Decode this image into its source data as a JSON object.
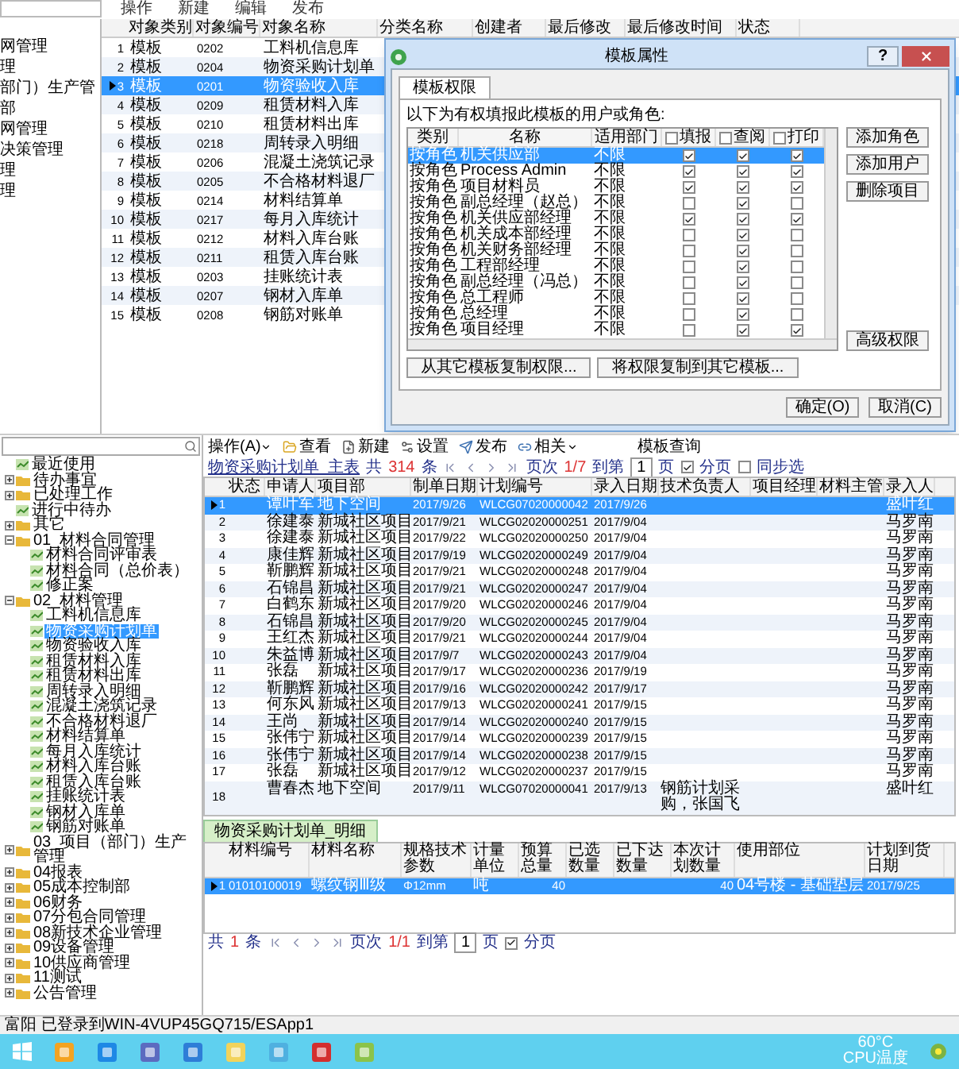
{
  "top_window": {
    "toolbar": [
      "操作",
      "新建",
      "编辑",
      "发布"
    ],
    "tree_fragment": [
      "网管理",
      "理",
      "部门）生产管",
      "部",
      "网管理",
      "决策管理",
      "理",
      "理"
    ],
    "grid": {
      "columns": [
        "对象类别",
        "对象编号",
        "对象名称",
        "分类名称",
        "创建者",
        "最后修改",
        "最后修改时间",
        "状态"
      ],
      "rows": [
        {
          "n": "1",
          "category": "模板",
          "code": "0202",
          "name": "工料机信息库",
          "selected": false
        },
        {
          "n": "2",
          "category": "模板",
          "code": "0204",
          "name": "物资采购计划单",
          "selected": false
        },
        {
          "n": "3",
          "category": "模板",
          "code": "0201",
          "name": "物资验收入库",
          "selected": true
        },
        {
          "n": "4",
          "category": "模板",
          "code": "0209",
          "name": "租赁材料入库",
          "selected": false
        },
        {
          "n": "5",
          "category": "模板",
          "code": "0210",
          "name": "租赁材料出库",
          "selected": false
        },
        {
          "n": "6",
          "category": "模板",
          "code": "0218",
          "name": "周转录入明细",
          "selected": false
        },
        {
          "n": "7",
          "category": "模板",
          "code": "0206",
          "name": "混凝土浇筑记录",
          "selected": false
        },
        {
          "n": "8",
          "category": "模板",
          "code": "0205",
          "name": "不合格材料退厂",
          "selected": false
        },
        {
          "n": "9",
          "category": "模板",
          "code": "0214",
          "name": "材料结算单",
          "selected": false
        },
        {
          "n": "10",
          "category": "模板",
          "code": "0217",
          "name": "每月入库统计",
          "selected": false
        },
        {
          "n": "11",
          "category": "模板",
          "code": "0212",
          "name": "材料入库台账",
          "selected": false
        },
        {
          "n": "12",
          "category": "模板",
          "code": "0211",
          "name": "租赁入库台账",
          "selected": false
        },
        {
          "n": "13",
          "category": "模板",
          "code": "0203",
          "name": "挂账统计表",
          "selected": false
        },
        {
          "n": "14",
          "category": "模板",
          "code": "0207",
          "name": "钢材入库单",
          "selected": false
        },
        {
          "n": "15",
          "category": "模板",
          "code": "0208",
          "name": "钢筋对账单",
          "selected": false
        }
      ]
    }
  },
  "dialog": {
    "title": "模板属性",
    "help_button": "?",
    "tabs": [
      {
        "label": "模板权限",
        "selected": true
      }
    ],
    "intro": "以下为有权填报此模板的用户或角色:",
    "columns": [
      "类别",
      "名称",
      "适用部门"
    ],
    "check_columns": [
      {
        "label": "填报",
        "checked": false
      },
      {
        "label": "查阅",
        "checked": false
      },
      {
        "label": "打印",
        "checked": false
      }
    ],
    "rows": [
      {
        "type": "按角色",
        "name": "机关供应部",
        "dept": "不限",
        "fill": true,
        "view": true,
        "print": true,
        "selected": true
      },
      {
        "type": "按角色",
        "name": "Process Admin",
        "dept": "不限",
        "fill": true,
        "view": true,
        "print": true,
        "selected": false
      },
      {
        "type": "按角色",
        "name": "项目材料员",
        "dept": "不限",
        "fill": true,
        "view": true,
        "print": true,
        "selected": false
      },
      {
        "type": "按角色",
        "name": "副总经理（赵总）",
        "dept": "不限",
        "fill": false,
        "view": true,
        "print": false,
        "selected": false
      },
      {
        "type": "按角色",
        "name": "机关供应部经理",
        "dept": "不限",
        "fill": true,
        "view": true,
        "print": true,
        "selected": false
      },
      {
        "type": "按角色",
        "name": "机关成本部经理",
        "dept": "不限",
        "fill": false,
        "view": true,
        "print": false,
        "selected": false
      },
      {
        "type": "按角色",
        "name": "机关财务部经理",
        "dept": "不限",
        "fill": false,
        "view": true,
        "print": false,
        "selected": false
      },
      {
        "type": "按角色",
        "name": "工程部经理",
        "dept": "不限",
        "fill": false,
        "view": true,
        "print": false,
        "selected": false
      },
      {
        "type": "按角色",
        "name": "副总经理（冯总）",
        "dept": "不限",
        "fill": false,
        "view": true,
        "print": false,
        "selected": false
      },
      {
        "type": "按角色",
        "name": "总工程师",
        "dept": "不限",
        "fill": false,
        "view": true,
        "print": false,
        "selected": false
      },
      {
        "type": "按角色",
        "name": "总经理",
        "dept": "不限",
        "fill": false,
        "view": true,
        "print": false,
        "selected": false
      },
      {
        "type": "按角色",
        "name": "项目经理",
        "dept": "不限",
        "fill": false,
        "view": true,
        "print": true,
        "selected": false
      }
    ],
    "side_buttons": [
      "添加角色",
      "添加用户",
      "删除项目"
    ],
    "advanced_button": "高级权限",
    "copy_buttons": [
      "从其它模板复制权限...",
      "将权限复制到其它模板..."
    ],
    "ok_button": "确定(O)",
    "cancel_button": "取消(C)"
  },
  "bottom_window": {
    "toolbar": {
      "menu": "操作(A)",
      "buttons": [
        {
          "label": "查看",
          "kind": "view"
        },
        {
          "label": "新建",
          "kind": "new"
        },
        {
          "label": "设置",
          "kind": "settings"
        },
        {
          "label": "发布",
          "kind": "publish"
        },
        {
          "label": "相关",
          "kind": "related"
        }
      ],
      "title": "模板查询"
    },
    "tree": [
      {
        "label": "最近使用",
        "kind": "doc"
      },
      {
        "label": "待办事宜",
        "kind": "folder",
        "expanded": false
      },
      {
        "label": "已处理工作",
        "kind": "folder",
        "expanded": false
      },
      {
        "label": "进行中待办",
        "kind": "doc"
      },
      {
        "label": "其它",
        "kind": "folder",
        "expanded": false
      },
      {
        "label": "01_材料合同管理",
        "kind": "folder",
        "expanded": true,
        "children": [
          {
            "label": "材料合同评审表",
            "kind": "doc"
          },
          {
            "label": "材料合同（总价表）",
            "kind": "doc"
          },
          {
            "label": "修正案",
            "kind": "doc"
          }
        ]
      },
      {
        "label": "02_材料管理",
        "kind": "folder",
        "expanded": true,
        "children": [
          {
            "label": "工料机信息库",
            "kind": "doc"
          },
          {
            "label": "物资采购计划单",
            "kind": "doc",
            "selected": true
          },
          {
            "label": "物资验收入库",
            "kind": "doc"
          },
          {
            "label": "租赁材料入库",
            "kind": "doc"
          },
          {
            "label": "租赁材料出库",
            "kind": "doc"
          },
          {
            "label": "周转录入明细",
            "kind": "doc"
          },
          {
            "label": "混凝土浇筑记录",
            "kind": "doc"
          },
          {
            "label": "不合格材料退厂",
            "kind": "doc"
          },
          {
            "label": "材料结算单",
            "kind": "doc"
          },
          {
            "label": "每月入库统计",
            "kind": "doc"
          },
          {
            "label": "材料入库台账",
            "kind": "doc"
          },
          {
            "label": "租赁入库台账",
            "kind": "doc"
          },
          {
            "label": "挂账统计表",
            "kind": "doc"
          },
          {
            "label": "钢材入库单",
            "kind": "doc"
          },
          {
            "label": "钢筋对账单",
            "kind": "doc"
          }
        ]
      },
      {
        "label": "03_项目（部门）生产管理",
        "kind": "folder",
        "expanded": false
      },
      {
        "label": "04报表",
        "kind": "folder",
        "expanded": false
      },
      {
        "label": "05成本控制部",
        "kind": "folder",
        "expanded": false
      },
      {
        "label": "06财务",
        "kind": "folder",
        "expanded": false
      },
      {
        "label": "07分包合同管理",
        "kind": "folder",
        "expanded": false
      },
      {
        "label": "08新技术企业管理",
        "kind": "folder",
        "expanded": false
      },
      {
        "label": "09设备管理",
        "kind": "folder",
        "expanded": false
      },
      {
        "label": "10供应商管理",
        "kind": "folder",
        "expanded": false
      },
      {
        "label": "11测试",
        "kind": "folder",
        "expanded": false
      },
      {
        "label": "公告管理",
        "kind": "folder",
        "expanded": false
      }
    ],
    "master_pager": {
      "table_name": "物资采购计划单_主表",
      "total_label": "共",
      "total": "314",
      "unit": "条",
      "page_label": "页次",
      "page": "1/7",
      "goto_label": "到第",
      "goto_value": "1",
      "page_unit": "页",
      "paging": {
        "label": "分页",
        "checked": true
      },
      "sync": {
        "label": "同步选",
        "checked": false
      }
    },
    "master": {
      "columns": [
        "状态",
        "申请人",
        "项目部",
        "制单日期",
        "计划编号",
        "录入日期",
        "技术负责人",
        "项目经理",
        "材料主管",
        "录入人"
      ],
      "rows": [
        {
          "n": "1",
          "applicant": "谭叶军",
          "project": "地下空间",
          "date": "2017/9/26",
          "plan": "WLCG07020000042",
          "entered": "2017/9/26",
          "tech": "",
          "clerk": "盛叶红",
          "selected": true
        },
        {
          "n": "2",
          "applicant": "徐建泰",
          "project": "新城社区项目",
          "date": "2017/9/21",
          "plan": "WLCG02020000251",
          "entered": "2017/9/04",
          "tech": "",
          "clerk": "马罗南",
          "selected": false
        },
        {
          "n": "3",
          "applicant": "徐建泰",
          "project": "新城社区项目",
          "date": "2017/9/22",
          "plan": "WLCG02020000250",
          "entered": "2017/9/04",
          "tech": "",
          "clerk": "马罗南",
          "selected": false
        },
        {
          "n": "4",
          "applicant": "康佳辉",
          "project": "新城社区项目",
          "date": "2017/9/19",
          "plan": "WLCG02020000249",
          "entered": "2017/9/04",
          "tech": "",
          "clerk": "马罗南",
          "selected": false
        },
        {
          "n": "5",
          "applicant": "靳鹏辉",
          "project": "新城社区项目",
          "date": "2017/9/21",
          "plan": "WLCG02020000248",
          "entered": "2017/9/04",
          "tech": "",
          "clerk": "马罗南",
          "selected": false
        },
        {
          "n": "6",
          "applicant": "石锦昌",
          "project": "新城社区项目",
          "date": "2017/9/21",
          "plan": "WLCG02020000247",
          "entered": "2017/9/04",
          "tech": "",
          "clerk": "马罗南",
          "selected": false
        },
        {
          "n": "7",
          "applicant": "白鹤东",
          "project": "新城社区项目",
          "date": "2017/9/20",
          "plan": "WLCG02020000246",
          "entered": "2017/9/04",
          "tech": "",
          "clerk": "马罗南",
          "selected": false
        },
        {
          "n": "8",
          "applicant": "石锦昌",
          "project": "新城社区项目",
          "date": "2017/9/20",
          "plan": "WLCG02020000245",
          "entered": "2017/9/04",
          "tech": "",
          "clerk": "马罗南",
          "selected": false
        },
        {
          "n": "9",
          "applicant": "王红杰",
          "project": "新城社区项目",
          "date": "2017/9/21",
          "plan": "WLCG02020000244",
          "entered": "2017/9/04",
          "tech": "",
          "clerk": "马罗南",
          "selected": false
        },
        {
          "n": "10",
          "applicant": "朱益博",
          "project": "新城社区项目",
          "date": "2017/9/7",
          "plan": "WLCG02020000243",
          "entered": "2017/9/04",
          "tech": "",
          "clerk": "马罗南",
          "selected": false
        },
        {
          "n": "11",
          "applicant": "张磊",
          "project": "新城社区项目",
          "date": "2017/9/17",
          "plan": "WLCG02020000236",
          "entered": "2017/9/19",
          "tech": "",
          "clerk": "马罗南",
          "selected": false
        },
        {
          "n": "12",
          "applicant": "靳鹏辉",
          "project": "新城社区项目",
          "date": "2017/9/16",
          "plan": "WLCG02020000242",
          "entered": "2017/9/17",
          "tech": "",
          "clerk": "马罗南",
          "selected": false
        },
        {
          "n": "13",
          "applicant": "何东风",
          "project": "新城社区项目",
          "date": "2017/9/13",
          "plan": "WLCG02020000241",
          "entered": "2017/9/15",
          "tech": "",
          "clerk": "马罗南",
          "selected": false
        },
        {
          "n": "14",
          "applicant": "王尚",
          "project": "新城社区项目",
          "date": "2017/9/14",
          "plan": "WLCG02020000240",
          "entered": "2017/9/15",
          "tech": "",
          "clerk": "马罗南",
          "selected": false
        },
        {
          "n": "15",
          "applicant": "张伟宁",
          "project": "新城社区项目",
          "date": "2017/9/14",
          "plan": "WLCG02020000239",
          "entered": "2017/9/15",
          "tech": "",
          "clerk": "马罗南",
          "selected": false
        },
        {
          "n": "16",
          "applicant": "张伟宁",
          "project": "新城社区项目",
          "date": "2017/9/14",
          "plan": "WLCG02020000238",
          "entered": "2017/9/15",
          "tech": "",
          "clerk": "马罗南",
          "selected": false
        },
        {
          "n": "17",
          "applicant": "张磊",
          "project": "新城社区项目",
          "date": "2017/9/12",
          "plan": "WLCG02020000237",
          "entered": "2017/9/15",
          "tech": "",
          "clerk": "马罗南",
          "selected": false
        },
        {
          "n": "18",
          "applicant": "曹春杰",
          "project": "地下空间",
          "date": "2017/9/11",
          "plan": "WLCG07020000041",
          "entered": "2017/9/13",
          "tech": "钢筋计划采购，张国飞",
          "clerk": "盛叶红",
          "selected": false
        }
      ]
    },
    "detail_tab": {
      "label": "物资采购计划单_明细",
      "selected": true
    },
    "detail": {
      "columns": [
        "材料编号",
        "材料名称",
        "规格技术参数",
        "计量单位",
        "预算总量",
        "已选数量",
        "已下达数量",
        "本次计划数量",
        "使用部位",
        "计划到货日期"
      ],
      "rows": [
        {
          "n": "1",
          "cells": [
            "01010100019",
            "螺纹钢Ⅲ级",
            "Φ12mm",
            "吨",
            "40",
            "",
            "",
            "40",
            "04号楼 - 基础垫层",
            "2017/9/25"
          ],
          "selected": true
        }
      ]
    },
    "detail_pager": {
      "total_label": "共",
      "total": "1",
      "unit": "条",
      "page_label": "页次",
      "page": "1/1",
      "goto_label": "到第",
      "goto_value": "1",
      "page_unit": "页",
      "paging": {
        "label": "分页",
        "checked": true
      }
    }
  },
  "status_bar": {
    "text": "富阳 已登录到WIN-4VUP45GQ715/ESApp1"
  },
  "taskbar": {
    "tray": [
      "60°C",
      "CPU温度"
    ]
  }
}
